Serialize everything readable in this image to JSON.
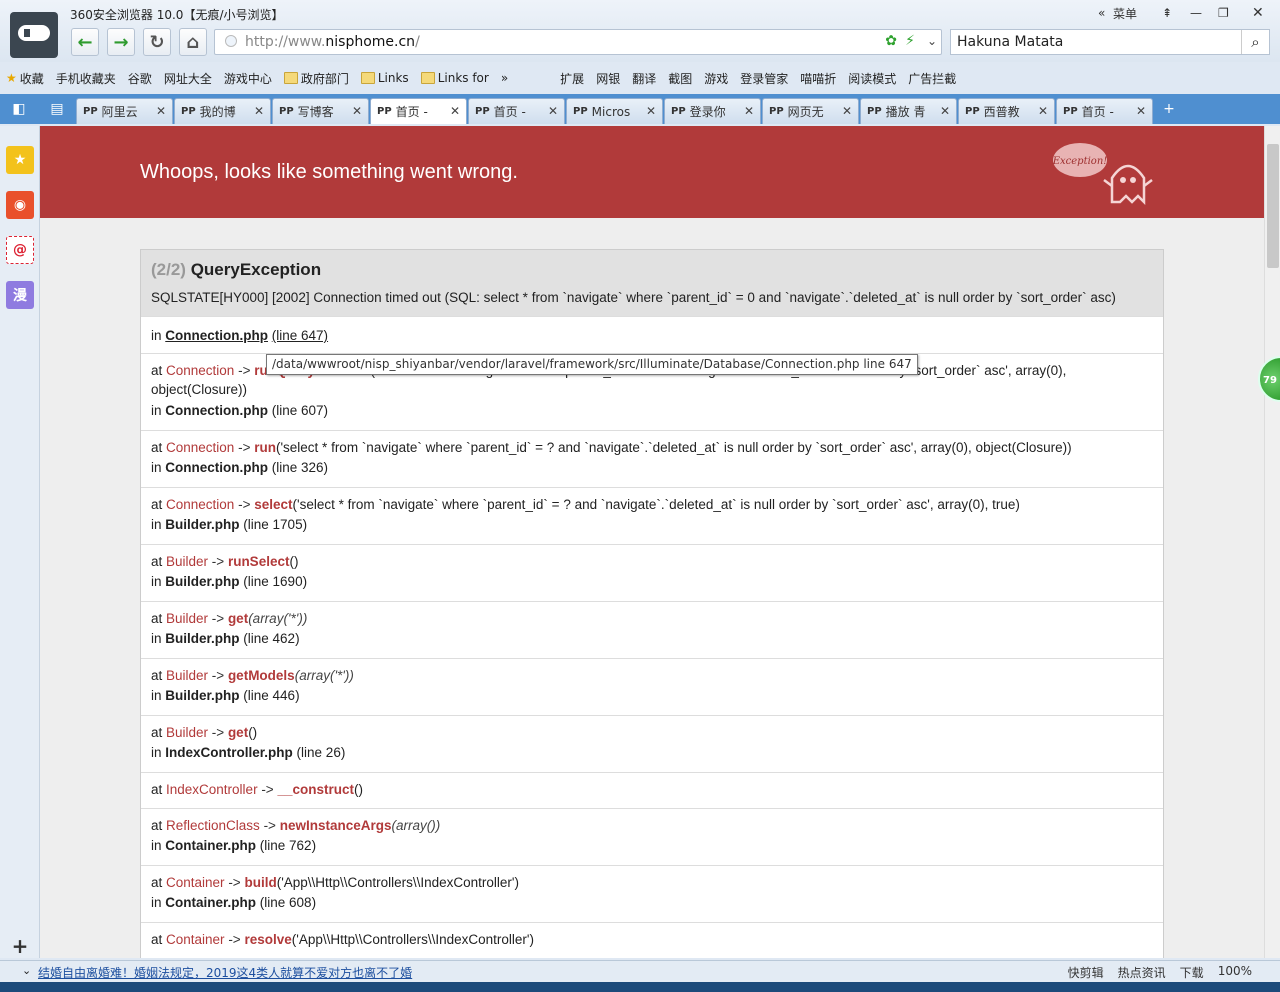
{
  "browser": {
    "title": "360安全浏览器 10.0【无痕/小号浏览】",
    "menu_label": "菜单",
    "url_prefix": "http://www.",
    "url_domain": "nisphome.cn",
    "url_path": "/",
    "search_value": "Hakuna Matata",
    "zoom": "100%"
  },
  "bookmarks": [
    "收藏",
    "手机收藏夹",
    "谷歌",
    "网址大全",
    "游戏中心",
    "政府部门",
    "Links",
    "Links for",
    "扩展",
    "网银",
    "翻译",
    "截图",
    "游戏",
    "登录管家",
    "喵喵折",
    "阅读模式",
    "广告拦截"
  ],
  "tabs": [
    "阿里云",
    "我的博",
    "写博客",
    "首页 -",
    "首页 -",
    "Micros",
    "登录你",
    "网页无",
    "播放 青",
    "西普教",
    "首页 -"
  ],
  "error": {
    "banner": "Whoops, looks like something went wrong.",
    "ghost_label": "Exception!",
    "count": "(2/2)",
    "exception": "QueryException",
    "message": "SQLSTATE[HY000] [2002] Connection timed out (SQL: select * from `navigate` where `parent_id` = 0 and `navigate`.`deleted_at` is null order by `sort_order` asc)",
    "first_file": "Connection.php",
    "first_line": "(line 647)",
    "tooltip": "/data/wwwroot/nisp_shiyanbar/vendor/laravel/framework/src/Illuminate/Database/Connection.php line 647",
    "frames": [
      {
        "cls": "Connection",
        "fn": "runQueryCallback",
        "args": "('select * from `navigate` where `parent_id` = ? and `navigate`.`deleted_at` is null order by `sort_order` asc', array(0), object(Closure))",
        "file": "Connection.php",
        "line": "(line 607)"
      },
      {
        "cls": "Connection",
        "fn": "run",
        "args": "('select * from `navigate` where `parent_id` = ? and `navigate`.`deleted_at` is null order by `sort_order` asc', array(0), object(Closure))",
        "file": "Connection.php",
        "line": "(line 326)"
      },
      {
        "cls": "Connection",
        "fn": "select",
        "args": "('select * from `navigate` where `parent_id` = ? and `navigate`.`deleted_at` is null order by `sort_order` asc', array(0), true)",
        "file": "Builder.php",
        "line": "(line 1705)"
      },
      {
        "cls": "Builder",
        "fn": "runSelect",
        "args": "()",
        "file": "Builder.php",
        "line": "(line 1690)"
      },
      {
        "cls": "Builder",
        "fn": "get",
        "args": "(array('*'))",
        "file": "Builder.php",
        "line": "(line 462)"
      },
      {
        "cls": "Builder",
        "fn": "getModels",
        "args": "(array('*'))",
        "file": "Builder.php",
        "line": "(line 446)"
      },
      {
        "cls": "Builder",
        "fn": "get",
        "args": "()",
        "file": "IndexController.php",
        "line": "(line 26)"
      },
      {
        "cls": "IndexController",
        "fn": "__construct",
        "args": "()",
        "file": "",
        "line": ""
      },
      {
        "cls": "ReflectionClass",
        "fn": "newInstanceArgs",
        "args": "(array())",
        "file": "Container.php",
        "line": "(line 762)"
      },
      {
        "cls": "Container",
        "fn": "build",
        "args": "('App\\\\Http\\\\Controllers\\\\IndexController')",
        "file": "Container.php",
        "line": "(line 608)"
      },
      {
        "cls": "Container",
        "fn": "resolve",
        "args": "('App\\\\Http\\\\Controllers\\\\IndexController')",
        "file": "",
        "line": ""
      }
    ]
  },
  "status": {
    "news": "结婚自由离婚难！婚姻法规定，2019这4类人就算不爱对方也离不了婚",
    "right": [
      "快剪辑",
      "热点资讯",
      "下载"
    ],
    "ball": "79"
  }
}
